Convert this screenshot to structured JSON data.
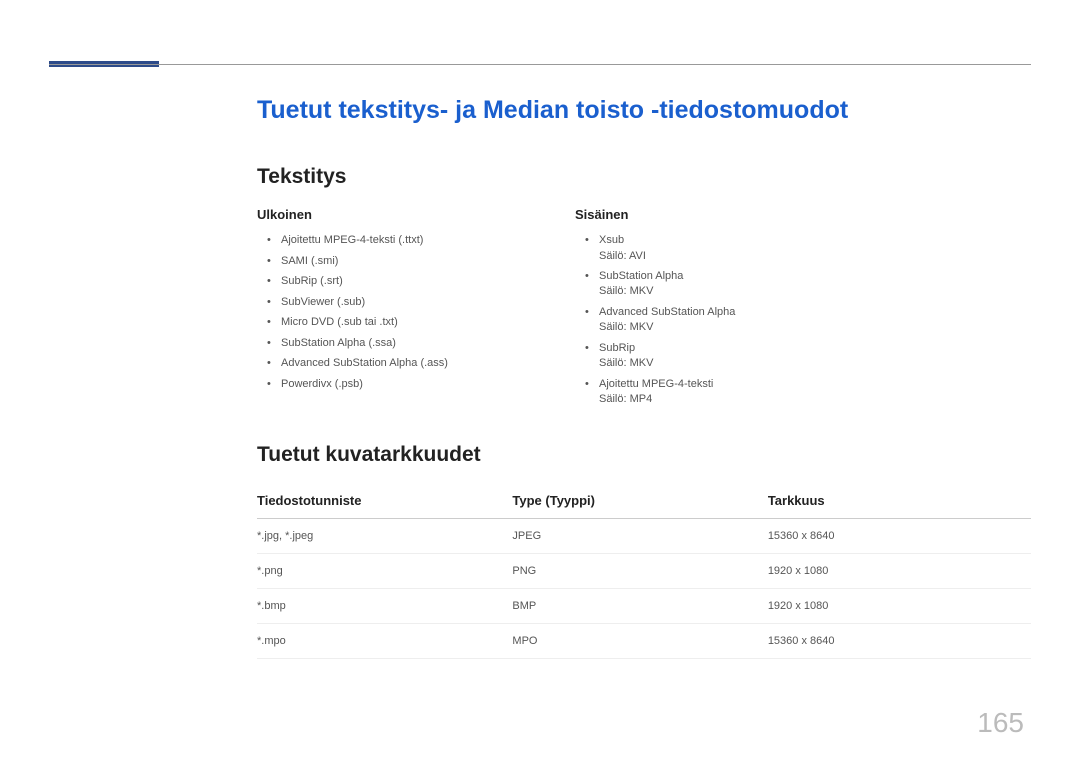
{
  "page_number": "165",
  "main_title": "Tuetut tekstitys- ja Median toisto -tiedostomuodot",
  "subtitle_section": {
    "title": "Tekstitys",
    "external": {
      "header": "Ulkoinen",
      "items": [
        "Ajoitettu MPEG-4-teksti (.ttxt)",
        "SAMI (.smi)",
        "SubRip (.srt)",
        "SubViewer (.sub)",
        "Micro DVD (.sub tai .txt)",
        "SubStation Alpha (.ssa)",
        "Advanced SubStation Alpha (.ass)",
        "Powerdivx (.psb)"
      ]
    },
    "internal": {
      "header": "Sisäinen",
      "items": [
        {
          "name": "Xsub",
          "container": "Säilö: AVI"
        },
        {
          "name": "SubStation Alpha",
          "container": "Säilö: MKV"
        },
        {
          "name": "Advanced SubStation Alpha",
          "container": "Säilö: MKV"
        },
        {
          "name": "SubRip",
          "container": "Säilö: MKV"
        },
        {
          "name": "Ajoitettu MPEG-4-teksti",
          "container": "Säilö: MP4"
        }
      ]
    }
  },
  "resolution_section": {
    "title": "Tuetut kuvatarkkuudet",
    "columns": [
      "Tiedostotunniste",
      "Type (Tyyppi)",
      "Tarkkuus"
    ],
    "rows": [
      {
        "ext": "*.jpg, *.jpeg",
        "type": "JPEG",
        "res": "15360 x 8640"
      },
      {
        "ext": "*.png",
        "type": "PNG",
        "res": "1920 x 1080"
      },
      {
        "ext": "*.bmp",
        "type": "BMP",
        "res": "1920 x 1080"
      },
      {
        "ext": "*.mpo",
        "type": "MPO",
        "res": "15360 x 8640"
      }
    ]
  }
}
